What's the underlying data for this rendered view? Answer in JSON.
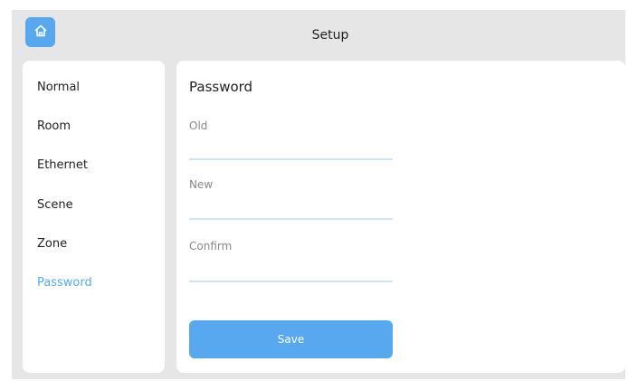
{
  "header": {
    "title": "Setup",
    "home_icon": "home-icon"
  },
  "sidebar": {
    "items": [
      {
        "label": "Normal"
      },
      {
        "label": "Room"
      },
      {
        "label": "Ethernet"
      },
      {
        "label": "Scene"
      },
      {
        "label": "Zone"
      },
      {
        "label": "Password",
        "active": true
      }
    ]
  },
  "panel": {
    "title": "Password",
    "fields": [
      {
        "label": "Old",
        "value": ""
      },
      {
        "label": "New",
        "value": ""
      },
      {
        "label": "Confirm",
        "value": ""
      }
    ],
    "save_label": "Save"
  },
  "colors": {
    "accent": "#58a8ef",
    "background": "#e6e6e6",
    "card": "#ffffff"
  }
}
